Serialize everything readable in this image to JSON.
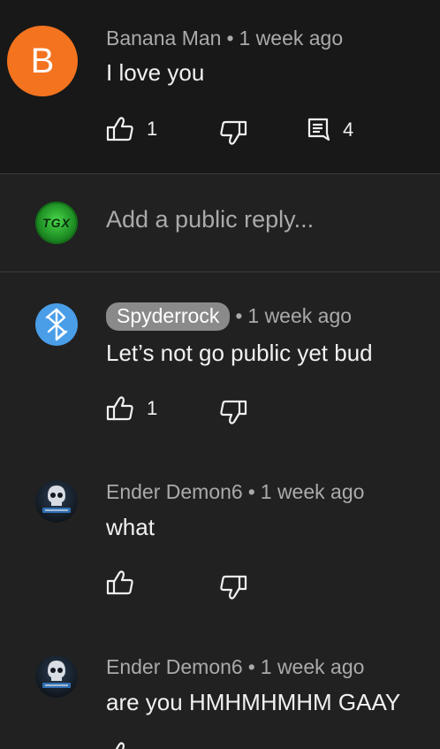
{
  "comments": [
    {
      "author": "Banana Man",
      "time": "1 week ago",
      "text": "I love you",
      "avatar_letter": "B",
      "avatar_color": "#f4731f",
      "likes": "1",
      "replies": "4"
    },
    {
      "author": "Spyderrock",
      "time": "1 week ago",
      "text": "Let’s not go public yet bud",
      "likes": "1"
    },
    {
      "author": "Ender Demon6",
      "time": "1 week ago",
      "text": "what"
    },
    {
      "author": "Ender Demon6",
      "time": "1 week ago",
      "text": "are you HMHMHMHM GAAY"
    }
  ],
  "reply_box": {
    "placeholder": "Add a public reply...",
    "avatar_text": "TGX"
  },
  "separator": "•",
  "icons": {
    "like": "thumbs-up-icon",
    "dislike": "thumbs-down-icon",
    "reply": "comment-icon",
    "bluetooth": "bluetooth-icon"
  },
  "colors": {
    "background": "#212121",
    "parent_background": "#181818",
    "meta_text": "#aaaaaa",
    "author_pill": "#8a8a8a"
  }
}
